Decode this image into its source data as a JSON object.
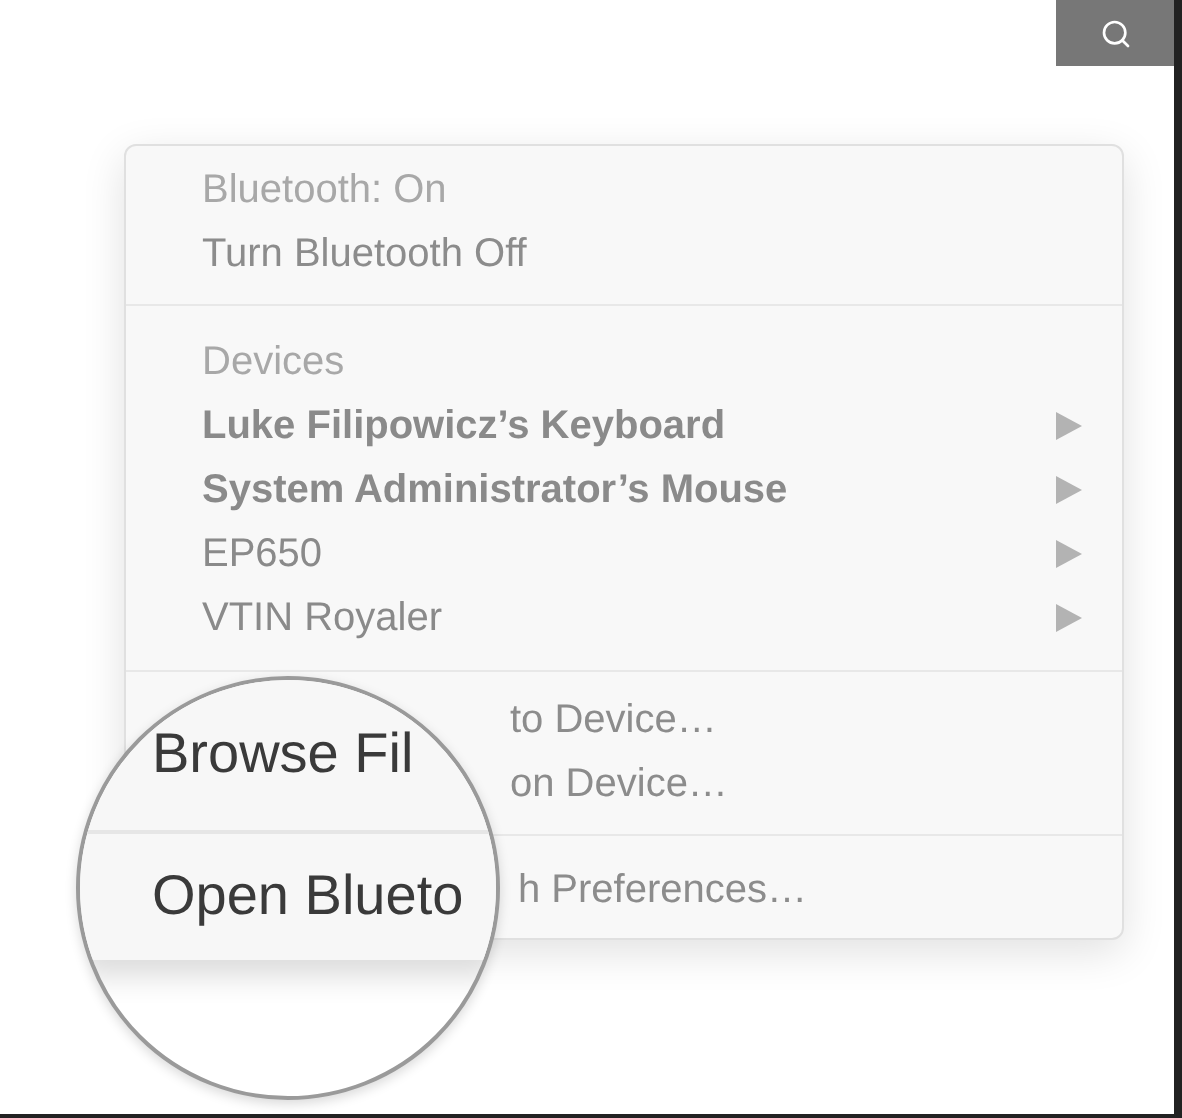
{
  "menu": {
    "sections": [
      {
        "kind": "plain",
        "items": [
          {
            "kind": "header",
            "label": "Bluetooth: On"
          },
          {
            "kind": "action",
            "label": "Turn Bluetooth Off"
          }
        ]
      },
      {
        "kind": "plain",
        "items": [
          {
            "kind": "header",
            "label": "Devices"
          },
          {
            "kind": "device",
            "label": "Luke Filipowicz’s Keyboard",
            "connected": true
          },
          {
            "kind": "device",
            "label": "System Administrator’s Mouse",
            "connected": true
          },
          {
            "kind": "device",
            "label": "EP650",
            "connected": false
          },
          {
            "kind": "device",
            "label": "VTIN Royaler",
            "connected": false
          }
        ]
      },
      {
        "kind": "covered",
        "items": [
          {
            "kind": "action",
            "label": "to Device…"
          },
          {
            "kind": "action",
            "label": "on Device…"
          }
        ]
      },
      {
        "kind": "covered",
        "items": [
          {
            "kind": "action",
            "label": "h Preferences…"
          }
        ]
      }
    ]
  },
  "magnifier": {
    "items": [
      "Browse Fil",
      "Open Blueto"
    ]
  }
}
